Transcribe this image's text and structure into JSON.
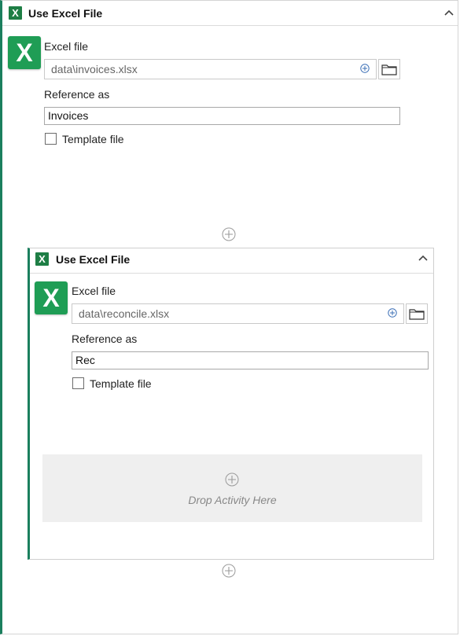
{
  "outer": {
    "title": "Use Excel File",
    "badge": "X",
    "icon_letter": "X",
    "excel_file_label": "Excel file",
    "excel_file_value": "data\\invoices.xlsx",
    "reference_label": "Reference as",
    "reference_value": "Invoices",
    "template_label": "Template file"
  },
  "inner": {
    "title": "Use Excel File",
    "badge": "X",
    "icon_letter": "X",
    "excel_file_label": "Excel file",
    "excel_file_value": "data\\reconcile.xlsx",
    "reference_label": "Reference as",
    "reference_value": "Rec",
    "template_label": "Template file",
    "drop_text": "Drop Activity Here"
  },
  "icons": {
    "collapse": "chevron-up-icon",
    "add": "plus-circle-icon",
    "browse": "folder-icon",
    "excel": "excel-icon"
  },
  "colors": {
    "accent": "#1b7f5e",
    "excel_green": "#1f9d55",
    "badge_green": "#1e7e45",
    "drop_zone": "#efefef"
  }
}
